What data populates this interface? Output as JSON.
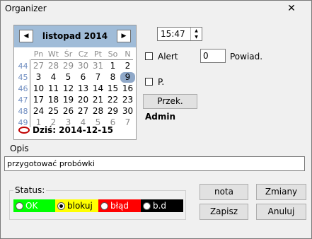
{
  "window": {
    "title": "Organizer",
    "close_glyph": "✕"
  },
  "calendar": {
    "month_label": "listopad 2014",
    "prev_glyph": "◀",
    "next_glyph": "▶",
    "weekdays": [
      "Pn",
      "Wt",
      "Śr",
      "Cz",
      "Pt",
      "So",
      "N"
    ],
    "weeks": [
      {
        "num": "44",
        "days": [
          "27",
          "28",
          "29",
          "30",
          "31",
          "1",
          "2"
        ]
      },
      {
        "num": "45",
        "days": [
          "3",
          "4",
          "5",
          "6",
          "7",
          "8",
          "9"
        ]
      },
      {
        "num": "46",
        "days": [
          "10",
          "11",
          "12",
          "13",
          "14",
          "15",
          "16"
        ]
      },
      {
        "num": "47",
        "days": [
          "17",
          "18",
          "19",
          "20",
          "21",
          "22",
          "23"
        ]
      },
      {
        "num": "48",
        "days": [
          "24",
          "25",
          "26",
          "27",
          "28",
          "29",
          "30"
        ]
      },
      {
        "num": "49",
        "days": [
          "1",
          "2",
          "3",
          "4",
          "5",
          "6",
          "7"
        ]
      }
    ],
    "selected_day": "9",
    "today_label": "Dziś: 2014-12-15",
    "today_color": "#c00000",
    "header_color": "#a0bcd8"
  },
  "time": {
    "value": "15:47"
  },
  "alert": {
    "label": "Alert",
    "checked": false
  },
  "powiad": {
    "value": "0",
    "label": "Powiad."
  },
  "p_check": {
    "label": "P.",
    "checked": false
  },
  "przek_button": "Przek.",
  "admin_label": "Admin",
  "opis": {
    "label": "Opis",
    "value": "przygotować probówki"
  },
  "status": {
    "legend": "Status:",
    "options": [
      {
        "label": "OK",
        "color": "#00ff00",
        "text_color": "#ffffff",
        "selected": false
      },
      {
        "label": "blokuj",
        "color": "#ffff00",
        "text_color": "#000000",
        "selected": true
      },
      {
        "label": "błąd",
        "color": "#ff0000",
        "text_color": "#ffffff",
        "selected": false
      },
      {
        "label": "b.d",
        "color": "#000000",
        "text_color": "#ffffff",
        "selected": false
      }
    ]
  },
  "buttons": {
    "nota": "nota",
    "zmiany": "Zmiany",
    "zapisz": "Zapisz",
    "anuluj": "Anuluj"
  }
}
